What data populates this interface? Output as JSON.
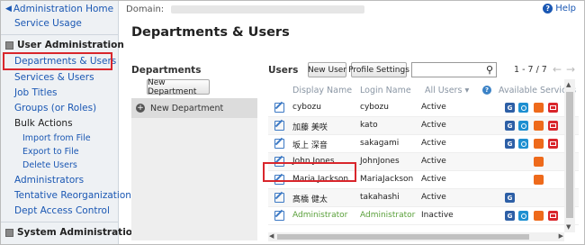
{
  "sidebar": {
    "home": "Administration Home",
    "service_usage": "Service Usage",
    "user_admin_heading": "User Administration",
    "items": [
      "Departments & Users",
      "Services & Users",
      "Job Titles",
      "Groups (or Roles)"
    ],
    "bulk_actions": "Bulk Actions",
    "bulk_sub": [
      "Import from File",
      "Export to File",
      "Delete Users"
    ],
    "items2": [
      "Administrators",
      "Tentative Reorganization",
      "Dept Access Control"
    ],
    "system_admin_heading": "System Administration"
  },
  "header": {
    "domain_label": "Domain:",
    "help": "Help"
  },
  "page_title": "Departments & Users",
  "departments": {
    "label": "Departments",
    "new_button": "New Department",
    "item": "New Department"
  },
  "users": {
    "label": "Users",
    "new_user_button": "New User",
    "profile_settings_button": "Profile Settings",
    "search_placeholder": "",
    "pager": "1 - 7 / 7",
    "columns": {
      "display_name": "Display Name",
      "login_name": "Login Name",
      "all_users": "All Users",
      "available_services": "Available Services"
    },
    "rows": [
      {
        "display": "cybozu",
        "login": "cybozu",
        "status": "Active",
        "services": [
          "G",
          "O",
          "M",
          "R"
        ]
      },
      {
        "display": "加藤 美咲",
        "login": "kato",
        "status": "Active",
        "services": [
          "G",
          "O",
          "M",
          "R"
        ]
      },
      {
        "display": "坂上 深音",
        "login": "sakagami",
        "status": "Active",
        "services": [
          "G",
          "O",
          "M",
          "R"
        ]
      },
      {
        "display": "John Jones",
        "login": "JohnJones",
        "status": "Active",
        "services": [
          "M"
        ]
      },
      {
        "display": "Maria Jackson",
        "login": "MariaJackson",
        "status": "Active",
        "services": [
          "M"
        ]
      },
      {
        "display": "髙橋 健太",
        "login": "takahashi",
        "status": "Active",
        "services": [
          "G"
        ]
      },
      {
        "display": "Administrator",
        "login": "Administrator",
        "status": "Inactive",
        "services": [
          "G",
          "O",
          "M",
          "R"
        ]
      }
    ]
  },
  "colors": {
    "link": "#1a57b3",
    "highlight_border": "#d9262c",
    "inactive_user": "#5aa03a"
  }
}
